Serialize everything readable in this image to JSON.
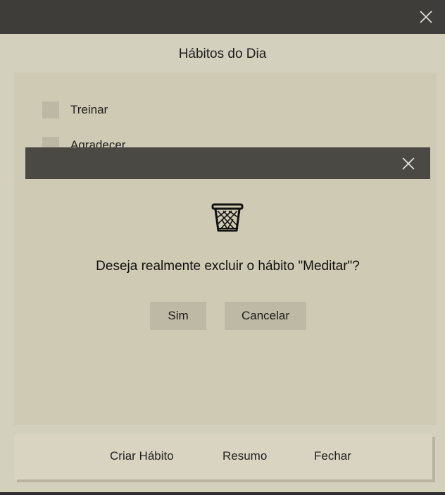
{
  "window": {
    "close_icon": "close-icon"
  },
  "page": {
    "title": "Hábitos do Dia"
  },
  "habits": [
    {
      "label": "Treinar",
      "checked": false
    },
    {
      "label": "Agradecer",
      "checked": false
    }
  ],
  "footer": {
    "create_label": "Criar Hábito",
    "summary_label": "Resumo",
    "close_label": "Fechar"
  },
  "dialog": {
    "icon": "trash-icon",
    "message": "Deseja realmente excluir o hábito \"Meditar\"?",
    "yes_label": "Sim",
    "cancel_label": "Cancelar"
  }
}
